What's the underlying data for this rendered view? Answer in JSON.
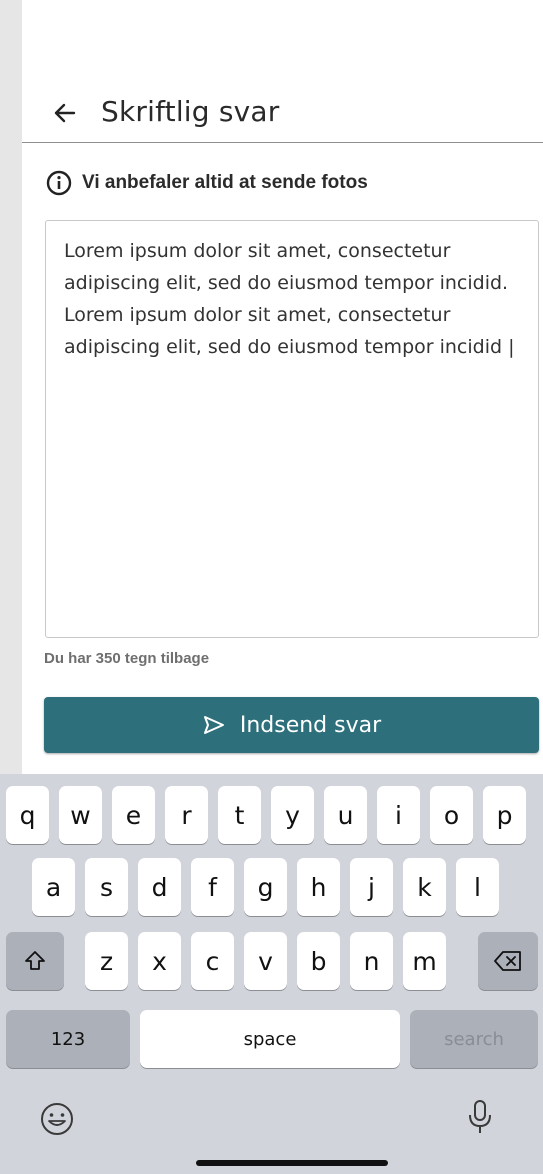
{
  "header": {
    "title": "Skriftlig svar"
  },
  "info": {
    "text": "Vi anbefaler altid at sende fotos"
  },
  "answer": {
    "value": "Lorem ipsum dolor sit amet, consectetur adipiscing elit, sed do eiusmod tempor incidid. Lorem ipsum dolor sit amet, consectetur adipiscing elit, sed do eiusmod tempor incidid |"
  },
  "counter": {
    "text": "Du har 350 tegn tilbage"
  },
  "submit": {
    "label": "Indsend svar",
    "color": "#2d707c"
  },
  "keyboard": {
    "row1": [
      "q",
      "w",
      "e",
      "r",
      "t",
      "y",
      "u",
      "i",
      "o",
      "p"
    ],
    "row2": [
      "a",
      "s",
      "d",
      "f",
      "g",
      "h",
      "j",
      "k",
      "l"
    ],
    "row3": [
      "z",
      "x",
      "c",
      "v",
      "b",
      "n",
      "m"
    ],
    "numbers_label": "123",
    "space_label": "space",
    "search_label": "search"
  },
  "icons": {
    "back": "arrow-left-icon",
    "info": "info-circle-icon",
    "send": "send-icon",
    "shift": "shift-icon",
    "delete": "backspace-icon",
    "emoji": "emoji-icon",
    "mic": "microphone-icon"
  }
}
